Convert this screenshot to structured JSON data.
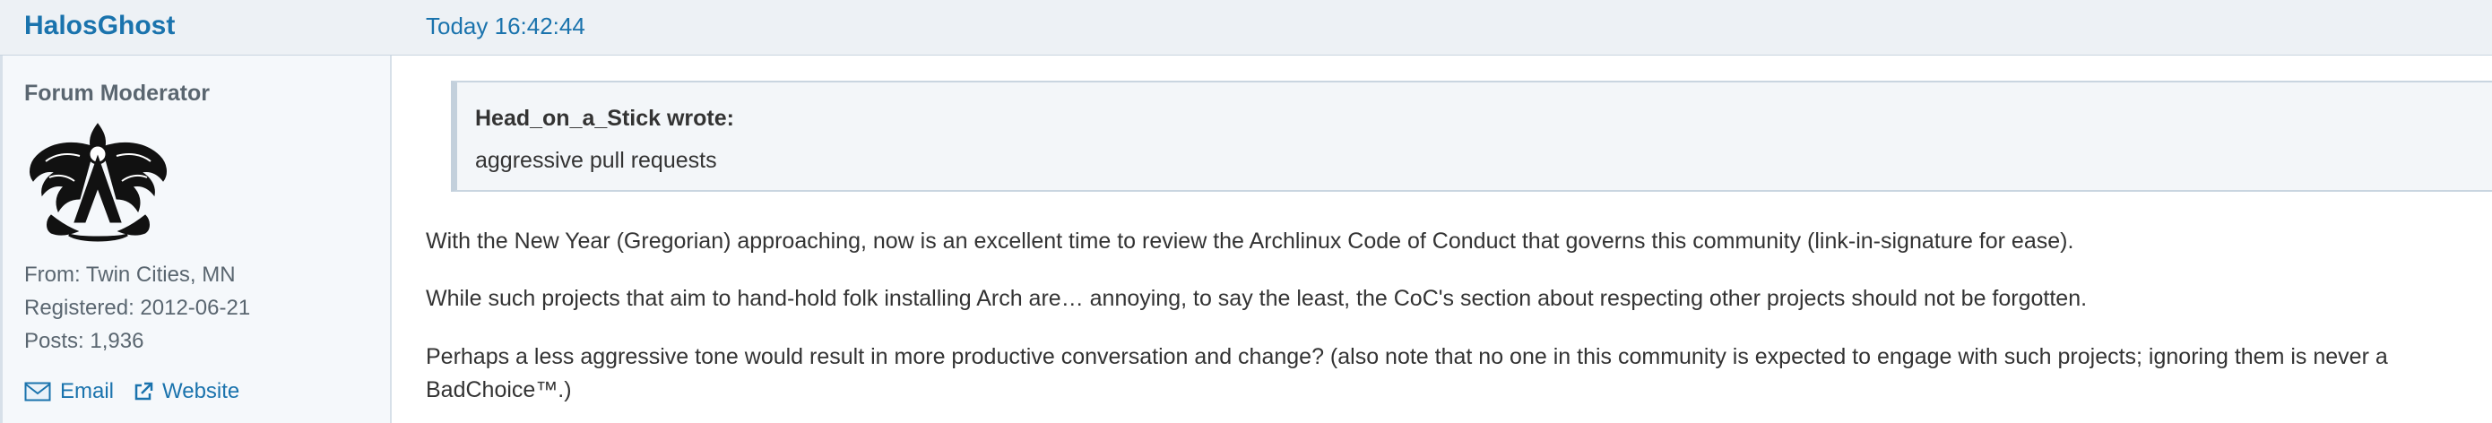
{
  "post": {
    "author": "HalosGhost",
    "timestamp": "Today 16:42:44"
  },
  "sidebar": {
    "role": "Forum Moderator",
    "avatar_icon": "arch-crest-avatar-icon",
    "from": "From: Twin Cities, MN",
    "registered": "Registered: 2012-06-21",
    "posts": "Posts: 1,936",
    "email_label": "Email",
    "website_label": "Website"
  },
  "quote": {
    "author": "Head_on_a_Stick wrote:",
    "text": "aggressive pull requests"
  },
  "body": {
    "p1": "With the New Year (Gregorian) approaching, now is an excellent time to review the Archlinux Code of Conduct that governs this community (link-in-signature for ease).",
    "p2": "While such projects that aim to hand-hold folk installing Arch are… annoying, to say the least, the CoC's section about respecting other projects should not be forgotten.",
    "p3_line1": "Perhaps a less aggressive tone would result in more productive conversation and change? (also note that no one in this community is expected to engage with such projects; ignoring them is never a",
    "p3_line2": "BadChoice™.)"
  },
  "colors": {
    "accent": "#1a73ad",
    "header_bg": "#edf1f5",
    "sidebar_bg": "#f5f8fb",
    "quote_bg": "#f3f6f9",
    "text": "#333333",
    "muted": "#5a6670"
  }
}
